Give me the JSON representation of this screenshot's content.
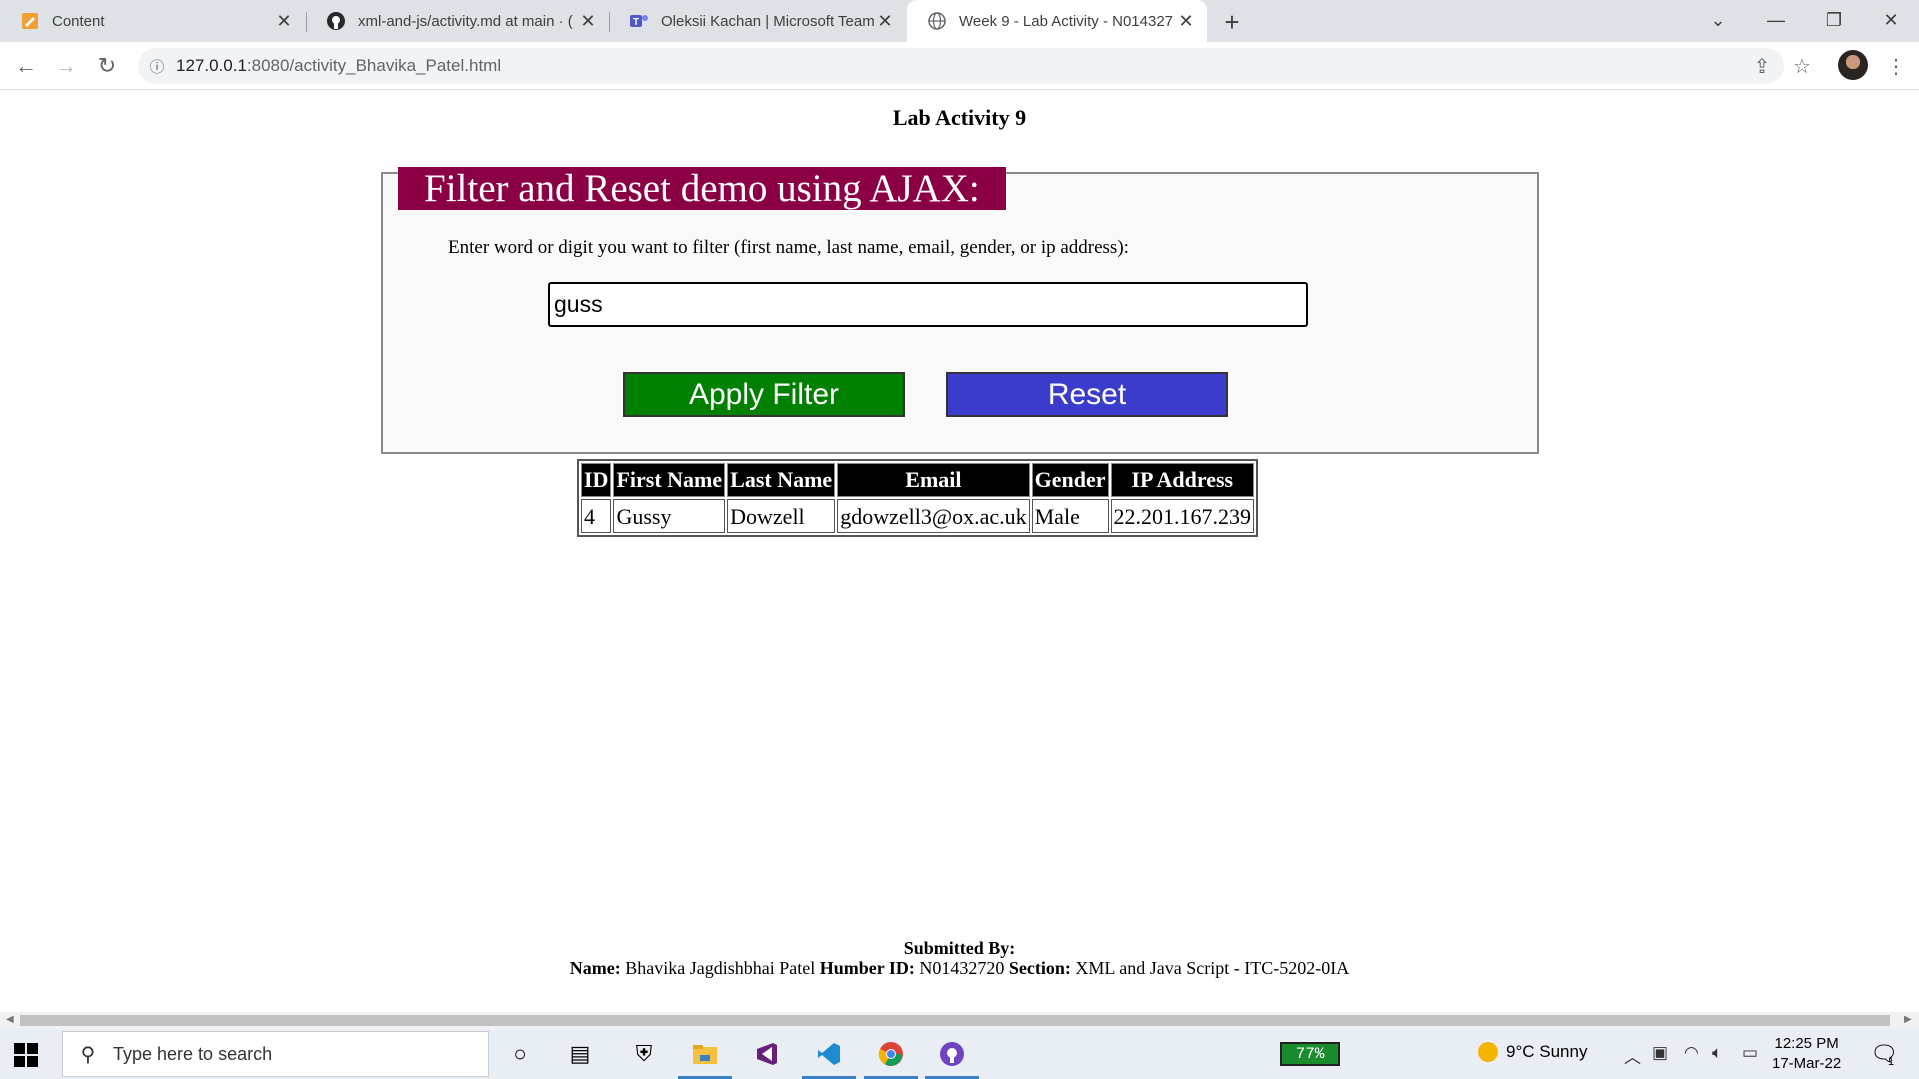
{
  "browser": {
    "tabs": [
      {
        "title": "Content",
        "icon": "edit-note-icon"
      },
      {
        "title": "xml-and-js/activity.md at main · (",
        "icon": "github-icon"
      },
      {
        "title": "Oleksii Kachan | Microsoft Teams",
        "icon": "teams-icon"
      },
      {
        "title": "Week 9 - Lab Activity - N014327",
        "icon": "globe-icon"
      }
    ],
    "url_host": "127.0.0.1",
    "url_path": ":8080/activity_Bhavika_Patel.html"
  },
  "page": {
    "title": "Lab Activity 9",
    "legend": "Filter and Reset demo using AJAX:",
    "prompt": "Enter word or digit you want to filter (first name, last name, email, gender, or ip address):",
    "filter_value": "guss",
    "apply_label": "Apply Filter",
    "reset_label": "Reset",
    "table": {
      "headers": [
        "ID",
        "First Name",
        "Last Name",
        "Email",
        "Gender",
        "IP Address"
      ],
      "rows": [
        [
          "4",
          "Gussy",
          "Dowzell",
          "gdowzell3@ox.ac.uk",
          "Male",
          "22.201.167.239"
        ]
      ]
    },
    "footer": {
      "submitted_by": "Submitted By:",
      "name_label": "Name:",
      "name_value": "Bhavika Jagdishbhai Patel",
      "id_label": "Humber ID:",
      "id_value": "N01432720",
      "section_label": "Section:",
      "section_value": "XML and Java Script - ITC-5202-0IA"
    }
  },
  "taskbar": {
    "search_placeholder": "Type here to search",
    "battery": "77%",
    "weather": "9°C  Sunny",
    "time": "12:25 PM",
    "date": "17-Mar-22",
    "notification_count": "1"
  },
  "colors": {
    "legend_bg": "#8b0045",
    "apply_bg": "#008000",
    "reset_bg": "#3b3bcc"
  }
}
